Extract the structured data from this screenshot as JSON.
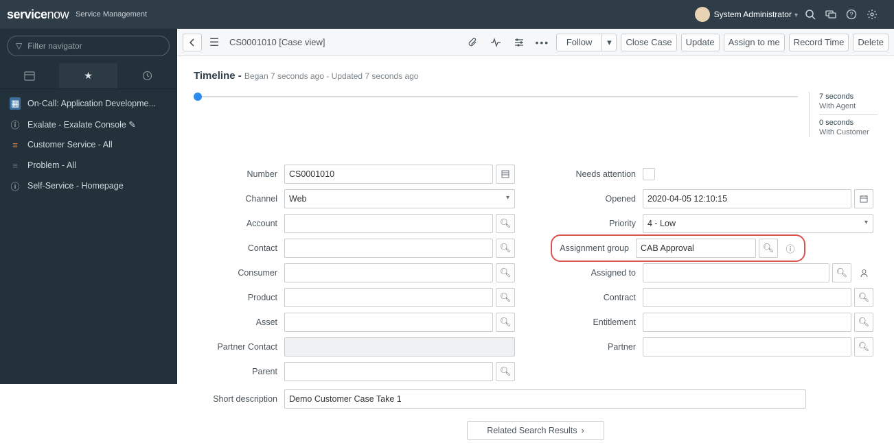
{
  "header": {
    "brand_a": "service",
    "brand_b": "now",
    "sub": "Service Management",
    "user": "System Administrator"
  },
  "nav": {
    "filter_placeholder": "Filter navigator",
    "items": [
      {
        "icon": "grid",
        "label": "On-Call: Application Developme..."
      },
      {
        "icon": "info",
        "label": "Exalate - Exalate Console ✎"
      },
      {
        "icon": "list",
        "label": "Customer Service - All"
      },
      {
        "icon": "list",
        "label": "Problem - All"
      },
      {
        "icon": "info",
        "label": "Self-Service - Homepage"
      }
    ]
  },
  "toolbar": {
    "breadcrumb": "CS0001010 [Case view]",
    "follow": "Follow",
    "close": "Close Case",
    "update": "Update",
    "assign": "Assign to me",
    "record_time": "Record Time",
    "delete": "Delete"
  },
  "timeline": {
    "title": "Timeline - ",
    "sub": "Began 7 seconds ago - Updated 7 seconds ago",
    "stat1a": "7 seconds",
    "stat1b": "With Agent",
    "stat2a": "0 seconds",
    "stat2b": "With Customer"
  },
  "form": {
    "left": {
      "number": {
        "label": "Number",
        "value": "CS0001010"
      },
      "channel": {
        "label": "Channel",
        "value": "Web"
      },
      "account": {
        "label": "Account",
        "value": ""
      },
      "contact": {
        "label": "Contact",
        "value": ""
      },
      "consumer": {
        "label": "Consumer",
        "value": ""
      },
      "product": {
        "label": "Product",
        "value": ""
      },
      "asset": {
        "label": "Asset",
        "value": ""
      },
      "partner_contact": {
        "label": "Partner Contact",
        "value": ""
      },
      "parent": {
        "label": "Parent",
        "value": ""
      }
    },
    "right": {
      "needs_attention": {
        "label": "Needs attention"
      },
      "opened": {
        "label": "Opened",
        "value": "2020-04-05 12:10:15"
      },
      "priority": {
        "label": "Priority",
        "value": "4 - Low"
      },
      "assignment_group": {
        "label": "Assignment group",
        "value": "CAB Approval"
      },
      "assigned_to": {
        "label": "Assigned to",
        "value": ""
      },
      "contract": {
        "label": "Contract",
        "value": ""
      },
      "entitlement": {
        "label": "Entitlement",
        "value": ""
      },
      "partner": {
        "label": "Partner",
        "value": ""
      }
    },
    "short_description": {
      "label": "Short description",
      "value": "Demo Customer Case Take 1"
    }
  },
  "related": {
    "label": "Related Search Results"
  }
}
